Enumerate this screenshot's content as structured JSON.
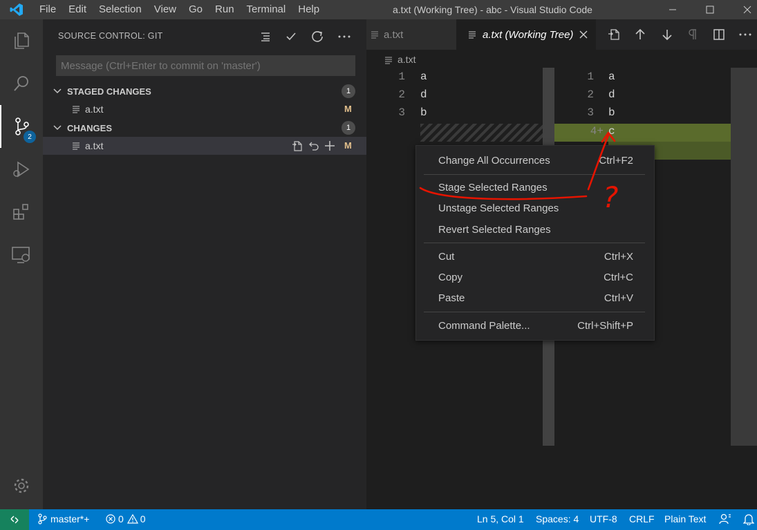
{
  "window": {
    "title": "a.txt (Working Tree) - abc - Visual Studio Code",
    "menu": [
      "File",
      "Edit",
      "Selection",
      "View",
      "Go",
      "Run",
      "Terminal",
      "Help"
    ]
  },
  "activity": {
    "scm_badge": "2"
  },
  "sidebar": {
    "title": "SOURCE CONTROL: GIT",
    "commit_placeholder": "Message (Ctrl+Enter to commit on 'master')",
    "staged": {
      "label": "STAGED CHANGES",
      "count": "1",
      "files": [
        {
          "name": "a.txt",
          "status": "M"
        }
      ]
    },
    "changes": {
      "label": "CHANGES",
      "count": "1",
      "files": [
        {
          "name": "a.txt",
          "status": "M"
        }
      ]
    }
  },
  "tabs": [
    {
      "label": "a.txt",
      "active": false
    },
    {
      "label": "a.txt (Working Tree)",
      "active": true
    }
  ],
  "editor": {
    "breadcrumb": "a.txt",
    "left_lines": [
      {
        "num": "1",
        "text": "a"
      },
      {
        "num": "2",
        "text": "d"
      },
      {
        "num": "3",
        "text": "b"
      }
    ],
    "right_lines": [
      {
        "num": "1",
        "text": "a"
      },
      {
        "num": "2",
        "text": "d"
      },
      {
        "num": "3",
        "text": "b"
      },
      {
        "num": "4+",
        "text": "c"
      }
    ]
  },
  "context_menu": {
    "items": [
      {
        "label": "Change All Occurrences",
        "key": "Ctrl+F2"
      },
      {
        "label": "Stage Selected Ranges",
        "key": ""
      },
      {
        "label": "Unstage Selected Ranges",
        "key": ""
      },
      {
        "label": "Revert Selected Ranges",
        "key": ""
      },
      {
        "label": "Cut",
        "key": "Ctrl+X"
      },
      {
        "label": "Copy",
        "key": "Ctrl+C"
      },
      {
        "label": "Paste",
        "key": "Ctrl+V"
      },
      {
        "label": "Command Palette...",
        "key": "Ctrl+Shift+P"
      }
    ]
  },
  "status_bar": {
    "branch": "master*+",
    "errors": "0",
    "warnings": "0",
    "position": "Ln 5, Col 1",
    "spaces": "Spaces: 4",
    "encoding": "UTF-8",
    "eol": "CRLF",
    "language": "Plain Text"
  },
  "annotation": {
    "question_mark": "?"
  },
  "colors": {
    "accent": "#007acc",
    "remote": "#16825d",
    "modified": "#e2c08d",
    "inserted": "#5a6b2c",
    "annotation": "#e51400"
  }
}
